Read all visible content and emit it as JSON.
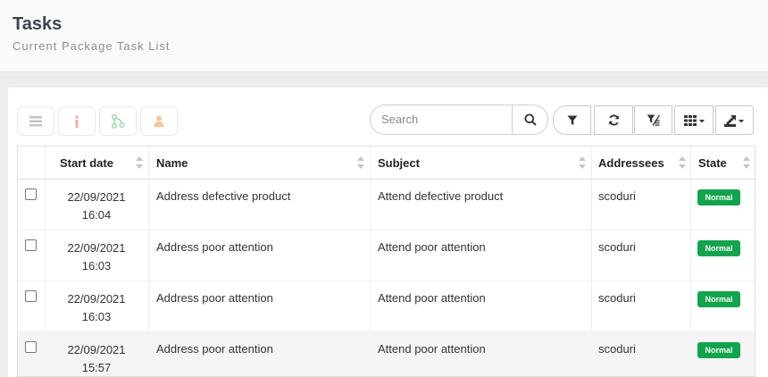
{
  "header": {
    "title": "Tasks",
    "subtitle": "Current Package Task List"
  },
  "toolbar": {
    "left_icons": [
      "list-icon",
      "info-icon",
      "graph-icon",
      "user-icon"
    ],
    "search_placeholder": "Search",
    "right_icons": [
      "filter-icon",
      "refresh-icon",
      "clear-filter-icon",
      "columns-icon",
      "export-icon"
    ]
  },
  "table": {
    "columns": [
      "Start date",
      "Name",
      "Subject",
      "Addressees",
      "State"
    ],
    "rows": [
      {
        "date": "22/09/2021",
        "time": "16:04",
        "name": "Address defective product",
        "subject": "Attend defective product",
        "addressees": "scoduri",
        "state": "Normal"
      },
      {
        "date": "22/09/2021",
        "time": "16:03",
        "name": "Address poor attention",
        "subject": "Attend poor attention",
        "addressees": "scoduri",
        "state": "Normal"
      },
      {
        "date": "22/09/2021",
        "time": "16:03",
        "name": "Address poor attention",
        "subject": "Attend poor attention",
        "addressees": "scoduri",
        "state": "Normal"
      },
      {
        "date": "22/09/2021",
        "time": "15:57",
        "name": "Address poor attention",
        "subject": "Attend poor attention",
        "addressees": "scoduri",
        "state": "Normal"
      }
    ]
  },
  "colors": {
    "badge": "#12a34d",
    "title": "#3a4451",
    "disabled_icon_list": "#b5b5b5",
    "disabled_icon_info": "#f3a9a9",
    "disabled_icon_graph": "#9fd8a8",
    "disabled_icon_user": "#f5c69a"
  }
}
